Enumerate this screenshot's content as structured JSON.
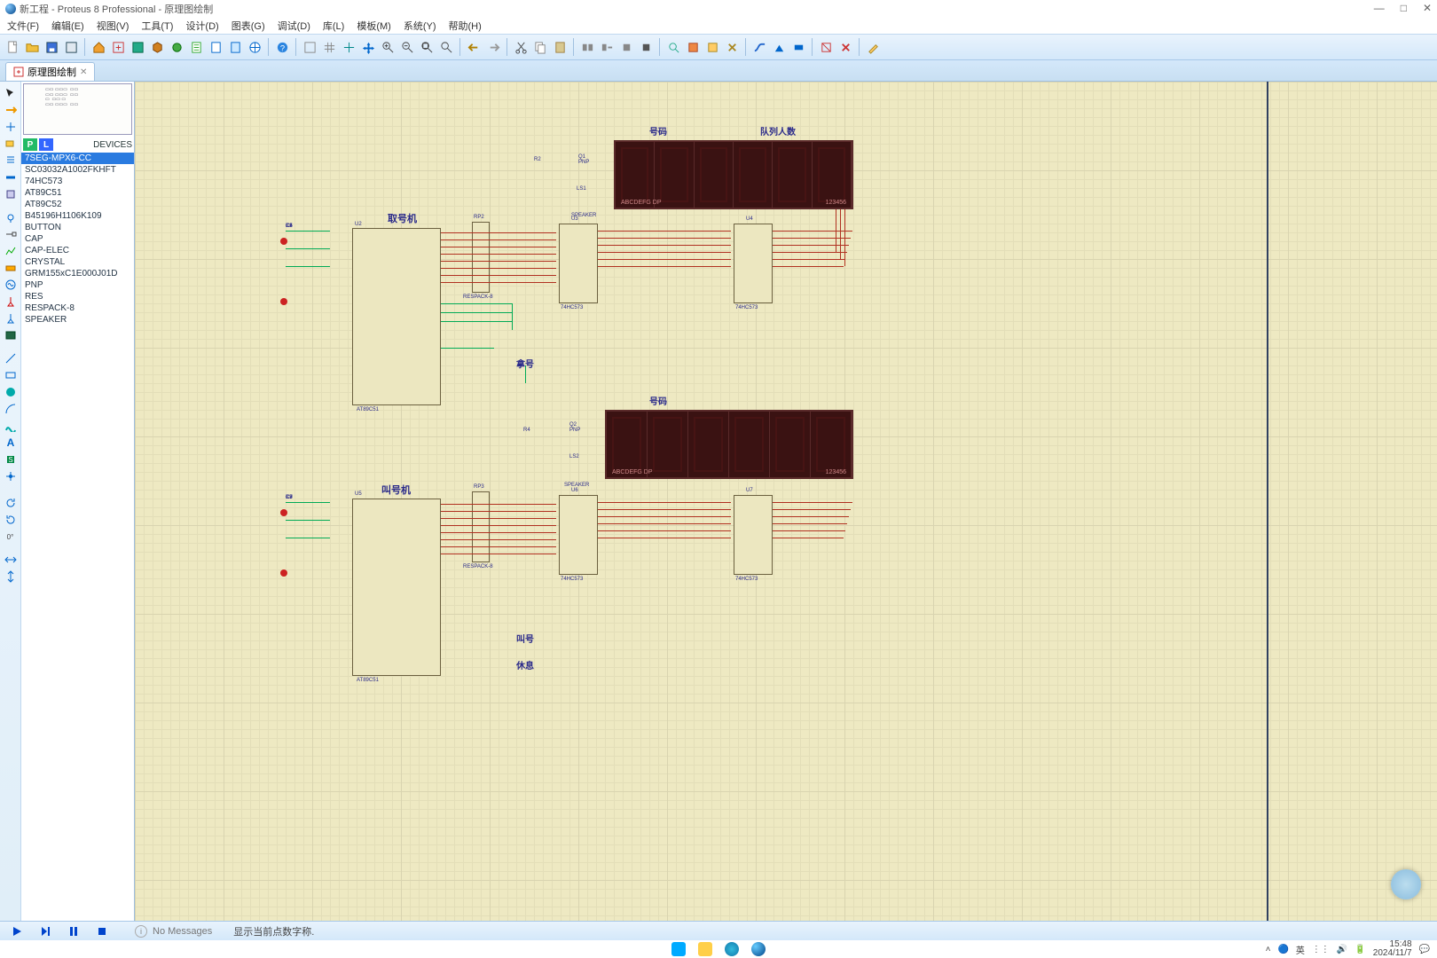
{
  "window": {
    "title": "新工程 - Proteus 8 Professional - 原理图绘制"
  },
  "menu": {
    "items": [
      "文件(F)",
      "编辑(E)",
      "视图(V)",
      "工具(T)",
      "设计(D)",
      "图表(G)",
      "调试(D)",
      "库(L)",
      "模板(M)",
      "系统(Y)",
      "帮助(H)"
    ]
  },
  "tabs": {
    "active": {
      "icon": "schematic",
      "label": "原理图绘制"
    }
  },
  "picker": {
    "p_label": "P",
    "l_label": "L",
    "heading": "DEVICES"
  },
  "devices": {
    "items": [
      "7SEG-MPX6-CC",
      "SC03032A1002FKHFT",
      "74HC573",
      "AT89C51",
      "AT89C52",
      "B45196H1106K109",
      "BUTTON",
      "CAP",
      "CAP-ELEC",
      "CRYSTAL",
      "GRM155xC1E000J01D",
      "PNP",
      "RES",
      "RESPACK-8",
      "SPEAKER"
    ],
    "selected_index": 0
  },
  "schematic": {
    "labels": {
      "title1": "取号机",
      "title2": "叫号机",
      "disp1a": "号码",
      "disp1b": "队列人数",
      "disp2a": "号码",
      "btn_take": "拿号",
      "btn_call": "叫号",
      "btn_rest": "休息"
    },
    "seg_caption_left": "ABCDEFG  DP",
    "seg_caption_right": "123456",
    "chips": {
      "u2": "AT89C51",
      "u3": "74HC573",
      "u4": "74HC573",
      "u5": "AT89C51",
      "u6": "74HC573",
      "u7": "74HC573",
      "rp2": "RESPACK-8",
      "rp3": "RESPACK-8"
    }
  },
  "simbar": {
    "msg": "No Messages",
    "hint": "显示当前点数字称."
  },
  "tray": {
    "ime": "英",
    "time": "15:48",
    "date": "2024/11/7"
  }
}
